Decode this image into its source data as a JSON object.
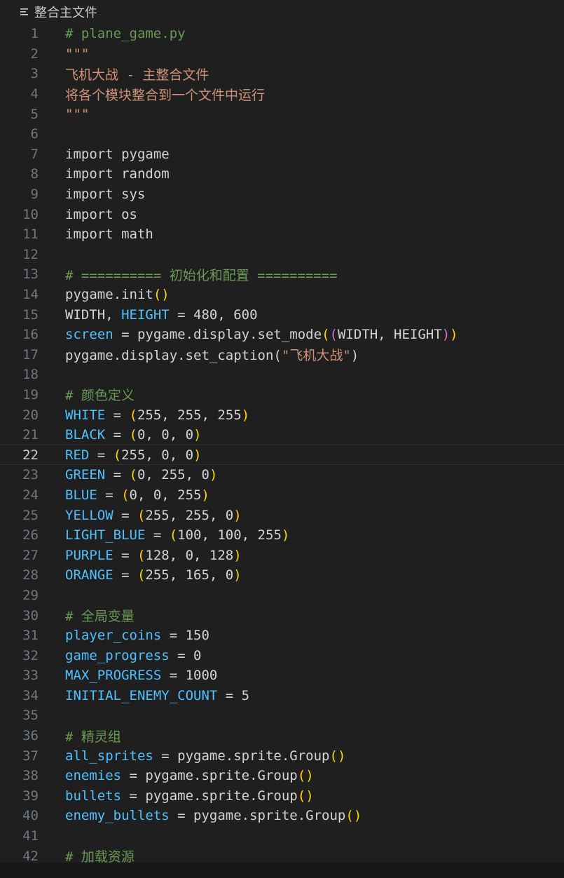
{
  "breadcrumb": {
    "icon": "symbol-file-icon",
    "label": "整合主文件"
  },
  "current_line": 22,
  "lines": [
    {
      "n": "1",
      "tokens": [
        [
          "c",
          "# plane_game.py"
        ]
      ]
    },
    {
      "n": "2",
      "tokens": [
        [
          "s",
          "\"\"\""
        ]
      ]
    },
    {
      "n": "3",
      "tokens": [
        [
          "s",
          "飞机大战 - 主整合文件"
        ]
      ]
    },
    {
      "n": "4",
      "tokens": [
        [
          "s",
          "将各个模块整合到一个文件中运行"
        ]
      ]
    },
    {
      "n": "5",
      "tokens": [
        [
          "s",
          "\"\"\""
        ]
      ]
    },
    {
      "n": "6",
      "tokens": []
    },
    {
      "n": "7",
      "tokens": [
        [
          "w",
          "import pygame"
        ]
      ]
    },
    {
      "n": "8",
      "tokens": [
        [
          "w",
          "import random"
        ]
      ]
    },
    {
      "n": "9",
      "tokens": [
        [
          "w",
          "import sys"
        ]
      ]
    },
    {
      "n": "10",
      "tokens": [
        [
          "w",
          "import os"
        ]
      ]
    },
    {
      "n": "11",
      "tokens": [
        [
          "w",
          "import math"
        ]
      ]
    },
    {
      "n": "12",
      "tokens": []
    },
    {
      "n": "13",
      "tokens": [
        [
          "c",
          "# ========== 初始化和配置 =========="
        ]
      ]
    },
    {
      "n": "14",
      "tokens": [
        [
          "w",
          "pygame.init"
        ],
        [
          "p1",
          "()"
        ]
      ]
    },
    {
      "n": "15",
      "tokens": [
        [
          "w",
          "WIDTH, "
        ],
        [
          "v",
          "HEIGHT"
        ],
        [
          "w",
          " = 480, 600"
        ]
      ]
    },
    {
      "n": "16",
      "tokens": [
        [
          "v",
          "screen"
        ],
        [
          "w",
          " = pygame.display.set_mode"
        ],
        [
          "p1",
          "("
        ],
        [
          "p2",
          "("
        ],
        [
          "w",
          "WIDTH, HEIGHT"
        ],
        [
          "p2",
          ")"
        ],
        [
          "p1",
          ")"
        ]
      ]
    },
    {
      "n": "17",
      "tokens": [
        [
          "w",
          "pygame.display.set_caption"
        ],
        [
          "w",
          "("
        ],
        [
          "s",
          "\"飞机大战\""
        ],
        [
          "w",
          ")"
        ]
      ]
    },
    {
      "n": "18",
      "tokens": []
    },
    {
      "n": "19",
      "tokens": [
        [
          "c",
          "# 颜色定义"
        ]
      ]
    },
    {
      "n": "20",
      "tokens": [
        [
          "v",
          "WHITE"
        ],
        [
          "w",
          " = "
        ],
        [
          "p1",
          "("
        ],
        [
          "w",
          "255, 255, 255"
        ],
        [
          "p1",
          ")"
        ]
      ]
    },
    {
      "n": "21",
      "tokens": [
        [
          "v",
          "BLACK"
        ],
        [
          "w",
          " = "
        ],
        [
          "p1",
          "("
        ],
        [
          "w",
          "0, 0, 0"
        ],
        [
          "p1",
          ")"
        ]
      ]
    },
    {
      "n": "22",
      "tokens": [
        [
          "v",
          "RED"
        ],
        [
          "w",
          " = "
        ],
        [
          "p1",
          "("
        ],
        [
          "w",
          "255, 0, 0"
        ],
        [
          "p1",
          ")"
        ]
      ]
    },
    {
      "n": "23",
      "tokens": [
        [
          "v",
          "GREEN"
        ],
        [
          "w",
          " = "
        ],
        [
          "p1",
          "("
        ],
        [
          "w",
          "0, 255, 0"
        ],
        [
          "p1",
          ")"
        ]
      ]
    },
    {
      "n": "24",
      "tokens": [
        [
          "v",
          "BLUE"
        ],
        [
          "w",
          " = "
        ],
        [
          "p1",
          "("
        ],
        [
          "w",
          "0, 0, 255"
        ],
        [
          "p1",
          ")"
        ]
      ]
    },
    {
      "n": "25",
      "tokens": [
        [
          "v",
          "YELLOW"
        ],
        [
          "w",
          " = "
        ],
        [
          "p1",
          "("
        ],
        [
          "w",
          "255, 255, 0"
        ],
        [
          "p1",
          ")"
        ]
      ]
    },
    {
      "n": "26",
      "tokens": [
        [
          "v",
          "LIGHT_BLUE"
        ],
        [
          "w",
          " = "
        ],
        [
          "p1",
          "("
        ],
        [
          "w",
          "100, 100, 255"
        ],
        [
          "p1",
          ")"
        ]
      ]
    },
    {
      "n": "27",
      "tokens": [
        [
          "v",
          "PURPLE"
        ],
        [
          "w",
          " = "
        ],
        [
          "p1",
          "("
        ],
        [
          "w",
          "128, 0, 128"
        ],
        [
          "p1",
          ")"
        ]
      ]
    },
    {
      "n": "28",
      "tokens": [
        [
          "v",
          "ORANGE"
        ],
        [
          "w",
          " = "
        ],
        [
          "p1",
          "("
        ],
        [
          "w",
          "255, 165, 0"
        ],
        [
          "p1",
          ")"
        ]
      ]
    },
    {
      "n": "29",
      "tokens": []
    },
    {
      "n": "30",
      "tokens": [
        [
          "c",
          "# 全局变量"
        ]
      ]
    },
    {
      "n": "31",
      "tokens": [
        [
          "v",
          "player_coins"
        ],
        [
          "w",
          " = 150"
        ]
      ]
    },
    {
      "n": "32",
      "tokens": [
        [
          "v",
          "game_progress"
        ],
        [
          "w",
          " = 0"
        ]
      ]
    },
    {
      "n": "33",
      "tokens": [
        [
          "v",
          "MAX_PROGRESS"
        ],
        [
          "w",
          " = 1000"
        ]
      ]
    },
    {
      "n": "34",
      "tokens": [
        [
          "v",
          "INITIAL_ENEMY_COUNT"
        ],
        [
          "w",
          " = 5"
        ]
      ]
    },
    {
      "n": "35",
      "tokens": []
    },
    {
      "n": "36",
      "tokens": [
        [
          "c",
          "# 精灵组"
        ]
      ]
    },
    {
      "n": "37",
      "tokens": [
        [
          "v",
          "all_sprites"
        ],
        [
          "w",
          " = pygame.sprite.Group"
        ],
        [
          "p1",
          "()"
        ]
      ]
    },
    {
      "n": "38",
      "tokens": [
        [
          "v",
          "enemies"
        ],
        [
          "w",
          " = pygame.sprite.Group"
        ],
        [
          "p1",
          "()"
        ]
      ]
    },
    {
      "n": "39",
      "tokens": [
        [
          "v",
          "bullets"
        ],
        [
          "w",
          " = pygame.sprite.Group"
        ],
        [
          "p1",
          "()"
        ]
      ]
    },
    {
      "n": "40",
      "tokens": [
        [
          "v",
          "enemy_bullets"
        ],
        [
          "w",
          " = pygame.sprite.Group"
        ],
        [
          "p1",
          "()"
        ]
      ]
    },
    {
      "n": "41",
      "tokens": []
    },
    {
      "n": "42",
      "tokens": [
        [
          "c",
          "# 加载资源"
        ]
      ]
    }
  ],
  "colors": {
    "comment": "#6a9955",
    "string": "#ce9178",
    "variable": "#4fc1ff",
    "plain": "#cccccc",
    "paren_level1": "#ffd700",
    "paren_level2": "#da70d6",
    "background": "#1f1f1f"
  }
}
